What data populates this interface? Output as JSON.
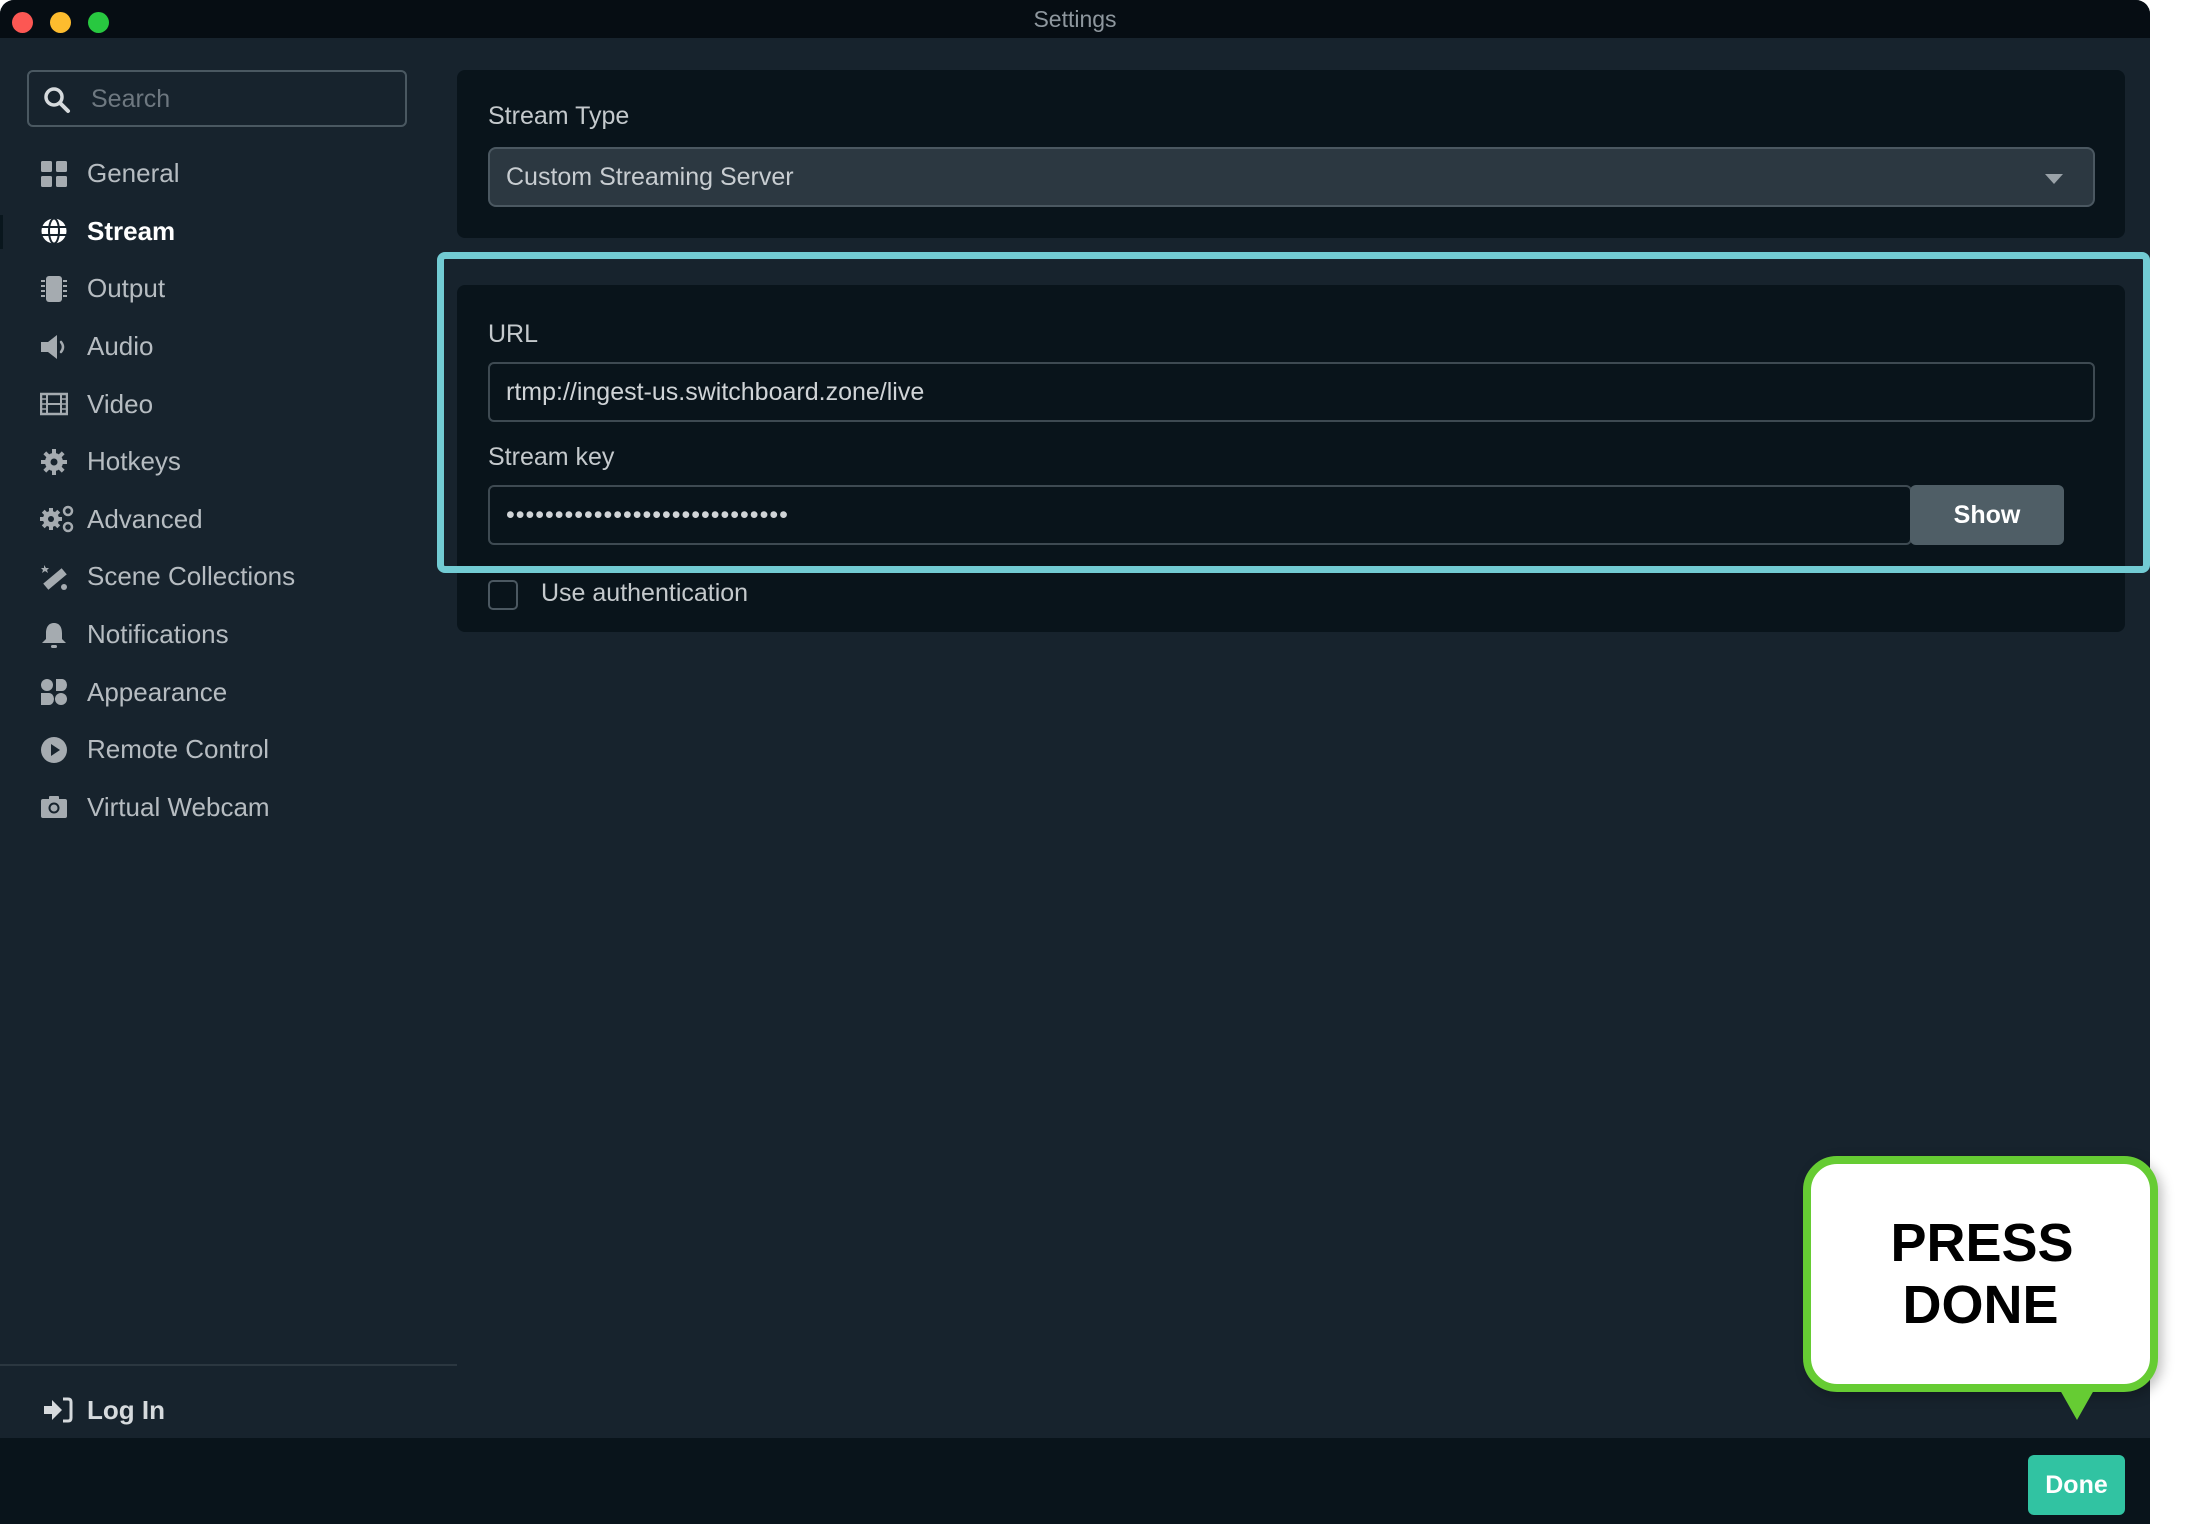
{
  "window": {
    "title": "Settings",
    "traffic_lights": [
      "close",
      "minimize",
      "maximize"
    ]
  },
  "sidebar": {
    "search": {
      "placeholder": "Search",
      "value": "",
      "icon": "search-icon"
    },
    "items": [
      {
        "label": "General",
        "icon": "grid-icon",
        "active": false
      },
      {
        "label": "Stream",
        "icon": "globe-icon",
        "active": true
      },
      {
        "label": "Output",
        "icon": "chip-icon",
        "active": false
      },
      {
        "label": "Audio",
        "icon": "speaker-icon",
        "active": false
      },
      {
        "label": "Video",
        "icon": "film-icon",
        "active": false
      },
      {
        "label": "Hotkeys",
        "icon": "gear-icon",
        "active": false
      },
      {
        "label": "Advanced",
        "icon": "gears-icon",
        "active": false
      },
      {
        "label": "Scene Collections",
        "icon": "magic-wand-icon",
        "active": false
      },
      {
        "label": "Notifications",
        "icon": "bell-icon",
        "active": false
      },
      {
        "label": "Appearance",
        "icon": "shapes-icon",
        "active": false
      },
      {
        "label": "Remote Control",
        "icon": "play-circle-icon",
        "active": false
      },
      {
        "label": "Virtual Webcam",
        "icon": "camera-icon",
        "active": false
      }
    ],
    "login": {
      "label": "Log In",
      "icon": "login-arrow-icon"
    }
  },
  "main": {
    "stream_type": {
      "label": "Stream Type",
      "selected": "Custom Streaming Server"
    },
    "url": {
      "label": "URL",
      "value": "rtmp://ingest-us.switchboard.zone/live"
    },
    "stream_key": {
      "label": "Stream key",
      "value": "•••••••••••••••••••••••••••••",
      "show_label": "Show"
    },
    "use_authentication": {
      "label": "Use authentication",
      "checked": false
    }
  },
  "footer": {
    "done_label": "Done"
  },
  "annotation": {
    "text": "PRESS DONE",
    "border_color": "#66cc33",
    "highlight_color": "#72cbd3"
  },
  "colors": {
    "done_button": "#31c3a2",
    "show_button": "#4f5e66"
  }
}
